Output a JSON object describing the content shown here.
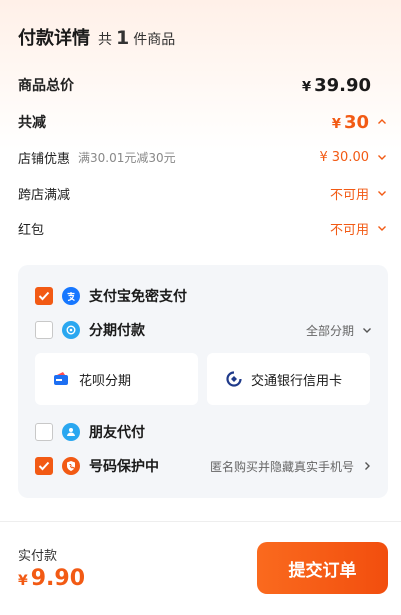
{
  "header": {
    "title": "付款详情",
    "count_prefix": "共",
    "count": "1",
    "count_suffix": "件商品"
  },
  "summary": {
    "total_label": "商品总价",
    "total_currency": "¥",
    "total_value": "39.90",
    "reduce_label": "共减",
    "reduce_currency": "¥",
    "reduce_value": "30",
    "store_discount_label": "店铺优惠",
    "store_discount_desc": "满30.01元减30元",
    "store_discount_currency": "¥",
    "store_discount_value": "30.00",
    "cross_store_label": "跨店满减",
    "cross_store_value": "不可用",
    "red_packet_label": "红包",
    "red_packet_value": "不可用"
  },
  "payment": {
    "alipay_label": "支付宝免密支付",
    "alipay_checked": true,
    "installment_label": "分期付款",
    "installment_checked": false,
    "installment_right": "全部分期",
    "huabei_label": "花呗分期",
    "bocom_label": "交通银行信用卡",
    "friend_label": "朋友代付",
    "friend_checked": false,
    "privacy_label": "号码保护中",
    "privacy_checked": true,
    "privacy_right": "匿名购买并隐藏真实手机号"
  },
  "footer": {
    "label": "实付款",
    "currency": "¥",
    "amount": "9.90",
    "submit_label": "提交订单"
  },
  "colors": {
    "accent": "#f25a14",
    "card_bg": "#f4f6f9"
  }
}
